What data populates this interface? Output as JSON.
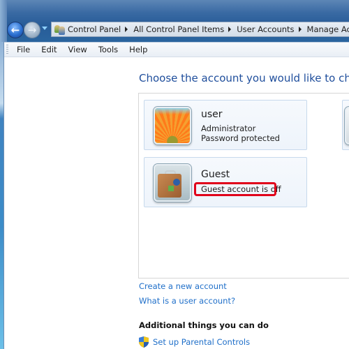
{
  "window": {
    "nav": {
      "back_icon": "back-arrow-icon",
      "forward_icon": "forward-arrow-icon",
      "recent_icon": "chevron-down-icon"
    },
    "address_bar": {
      "icon": "user-accounts-icon",
      "breadcrumbs": [
        "Control Panel",
        "All Control Panel Items",
        "User Accounts",
        "Manage Accounts"
      ]
    },
    "menu": [
      "File",
      "Edit",
      "View",
      "Tools",
      "Help"
    ]
  },
  "main": {
    "title": "Choose the account you would like to change",
    "accounts": [
      {
        "name": "user",
        "lines": [
          "Administrator",
          "Password protected"
        ],
        "avatar": "flower-picture"
      },
      {
        "name": "Guest",
        "lines": [
          "Guest account is off"
        ],
        "avatar": "suitcase-picture",
        "highlighted": true
      }
    ],
    "links": {
      "create": "Create a new account",
      "what_is": "What is a user account?"
    },
    "additional": {
      "heading": "Additional things you can do",
      "items": [
        {
          "label": "Set up Parental Controls",
          "icon": "uac-shield-icon"
        }
      ]
    }
  },
  "colors": {
    "title_blue": "#1f4e9c",
    "link_blue": "#1f6fc9",
    "highlight_red": "#e0001a"
  }
}
